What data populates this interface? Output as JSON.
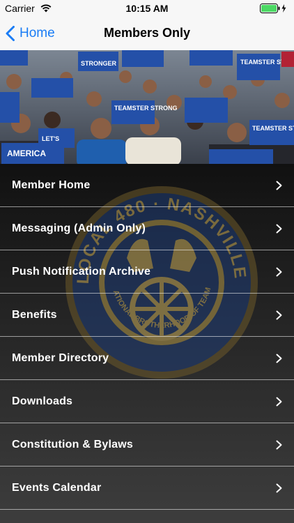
{
  "status": {
    "carrier": "Carrier",
    "time": "10:15 AM"
  },
  "nav": {
    "back_label": "Home",
    "title": "Members Only"
  },
  "banner": {
    "signs": [
      "TEAMSTER STRONG",
      "STRONGER",
      "AMERICA",
      "LET'S"
    ]
  },
  "seal": {
    "outer_text": "TEAMSTERS LOCAL 480 · NASHVILLE, TENNESSEE",
    "inner_text": "INTERNATIONAL BROTHERHOOD OF TEAMSTERS"
  },
  "menu": {
    "items": [
      {
        "label": "Member Home"
      },
      {
        "label": "Messaging (Admin Only)"
      },
      {
        "label": "Push Notification Archive"
      },
      {
        "label": "Benefits"
      },
      {
        "label": "Member Directory"
      },
      {
        "label": "Downloads"
      },
      {
        "label": "Constitution & Bylaws"
      },
      {
        "label": "Events Calendar"
      }
    ]
  },
  "colors": {
    "accent": "#1a7cf5",
    "battery": "#4cd964"
  },
  "icons": {
    "back": "chevron-left-icon",
    "row": "chevron-right-icon"
  }
}
